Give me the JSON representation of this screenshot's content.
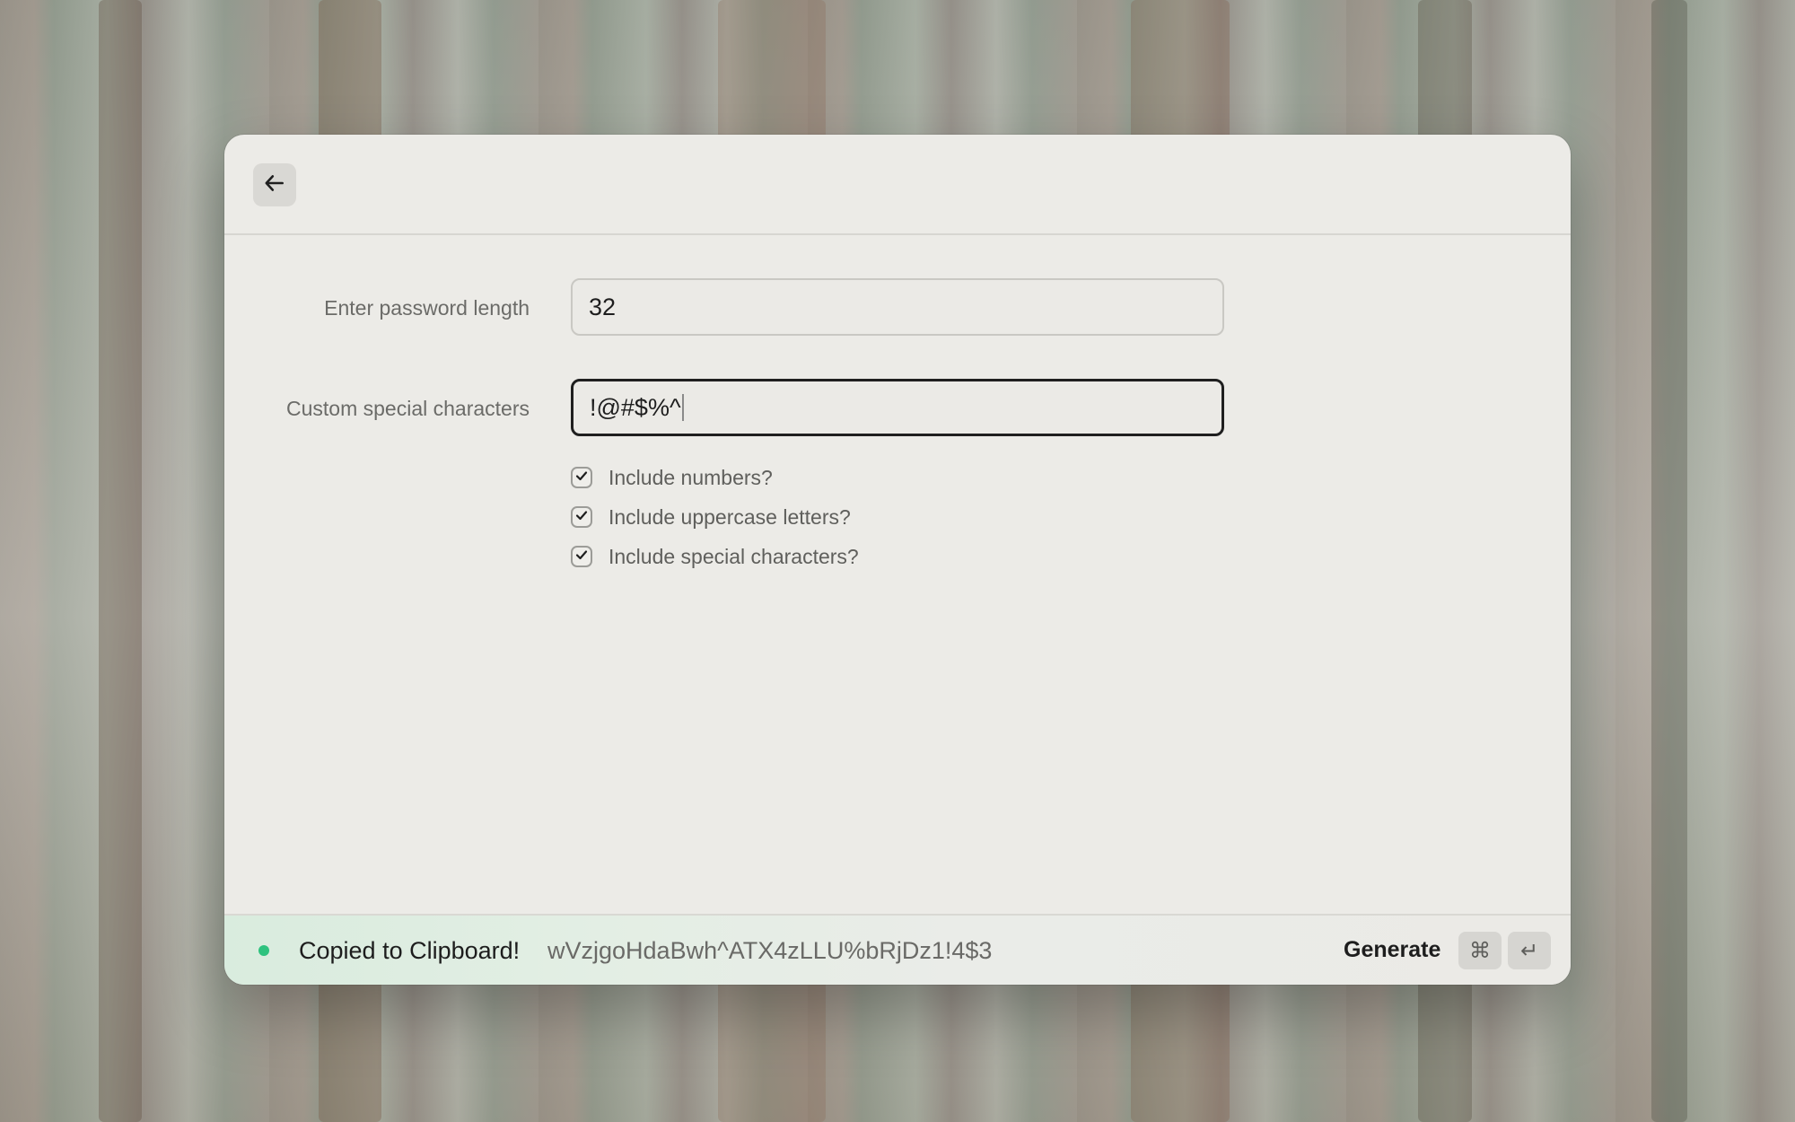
{
  "form": {
    "length_label": "Enter password length",
    "length_value": "32",
    "special_label": "Custom special characters",
    "special_value": "!@#$%^"
  },
  "options": [
    {
      "label": "Include numbers?",
      "checked": true
    },
    {
      "label": "Include uppercase letters?",
      "checked": true
    },
    {
      "label": "Include special characters?",
      "checked": true
    }
  ],
  "footer": {
    "status": "Copied to Clipboard!",
    "password": "wVzjgoHdaBwh^ATX4zLLU%bRjDz1!4$3",
    "action_label": "Generate",
    "shortcut_cmd": "⌘",
    "shortcut_enter": "↵"
  },
  "icons": {
    "back": "arrow-left-icon",
    "status": "status-dot-icon",
    "check": "checkmark-icon"
  },
  "colors": {
    "status_dot": "#2ec27e",
    "window_bg": "#ecebe7"
  }
}
